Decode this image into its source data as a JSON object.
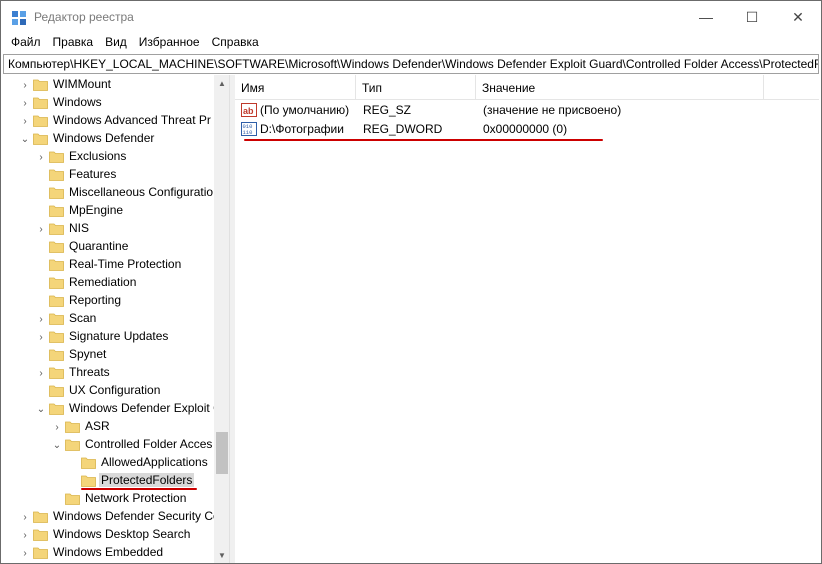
{
  "window": {
    "title": "Редактор реестра"
  },
  "titlebar_buttons": {
    "minimize": "—",
    "maximize": "☐",
    "close": "✕"
  },
  "menu": [
    "Файл",
    "Правка",
    "Вид",
    "Избранное",
    "Справка"
  ],
  "address": "Компьютер\\HKEY_LOCAL_MACHINE\\SOFTWARE\\Microsoft\\Windows Defender\\Windows Defender Exploit Guard\\Controlled Folder Access\\ProtectedFo",
  "tree": [
    {
      "label": "WIMMount",
      "level": 0,
      "expander": "›"
    },
    {
      "label": "Windows",
      "level": 0,
      "expander": "›"
    },
    {
      "label": "Windows Advanced Threat Pr",
      "level": 0,
      "expander": "›"
    },
    {
      "label": "Windows Defender",
      "level": 0,
      "expander": "⌄"
    },
    {
      "label": "Exclusions",
      "level": 1,
      "expander": "›"
    },
    {
      "label": "Features",
      "level": 1,
      "expander": ""
    },
    {
      "label": "Miscellaneous Configuratio",
      "level": 1,
      "expander": ""
    },
    {
      "label": "MpEngine",
      "level": 1,
      "expander": ""
    },
    {
      "label": "NIS",
      "level": 1,
      "expander": "›"
    },
    {
      "label": "Quarantine",
      "level": 1,
      "expander": ""
    },
    {
      "label": "Real-Time Protection",
      "level": 1,
      "expander": ""
    },
    {
      "label": "Remediation",
      "level": 1,
      "expander": ""
    },
    {
      "label": "Reporting",
      "level": 1,
      "expander": ""
    },
    {
      "label": "Scan",
      "level": 1,
      "expander": "›"
    },
    {
      "label": "Signature Updates",
      "level": 1,
      "expander": "›"
    },
    {
      "label": "Spynet",
      "level": 1,
      "expander": ""
    },
    {
      "label": "Threats",
      "level": 1,
      "expander": "›"
    },
    {
      "label": "UX Configuration",
      "level": 1,
      "expander": ""
    },
    {
      "label": "Windows Defender Exploit G",
      "level": 1,
      "expander": "⌄"
    },
    {
      "label": "ASR",
      "level": 2,
      "expander": "›"
    },
    {
      "label": "Controlled Folder Acces",
      "level": 2,
      "expander": "⌄"
    },
    {
      "label": "AllowedApplications",
      "level": 3,
      "expander": ""
    },
    {
      "label": "ProtectedFolders",
      "level": 3,
      "expander": "",
      "selected": true
    },
    {
      "label": "Network Protection",
      "level": 2,
      "expander": ""
    },
    {
      "label": "Windows Defender Security Ce",
      "level": 0,
      "expander": "›"
    },
    {
      "label": "Windows Desktop Search",
      "level": 0,
      "expander": "›"
    },
    {
      "label": "Windows Embedded",
      "level": 0,
      "expander": "›"
    }
  ],
  "scrollbar": {
    "up": "▲",
    "down": "▼"
  },
  "columns": {
    "name": "Имя",
    "type": "Тип",
    "value": "Значение"
  },
  "values": [
    {
      "name": "(По умолчанию)",
      "type": "REG_SZ",
      "data": "(значение не присвоено)",
      "icon": "string-value-icon"
    },
    {
      "name": "D:\\Фотографии",
      "type": "REG_DWORD",
      "data": "0x00000000 (0)",
      "icon": "binary-value-icon"
    }
  ],
  "colors": {
    "folder": "#f4d57a",
    "folder_edge": "#d9b44a",
    "highlight_underline": "#cc0000",
    "selection": "#d9d9d9"
  }
}
